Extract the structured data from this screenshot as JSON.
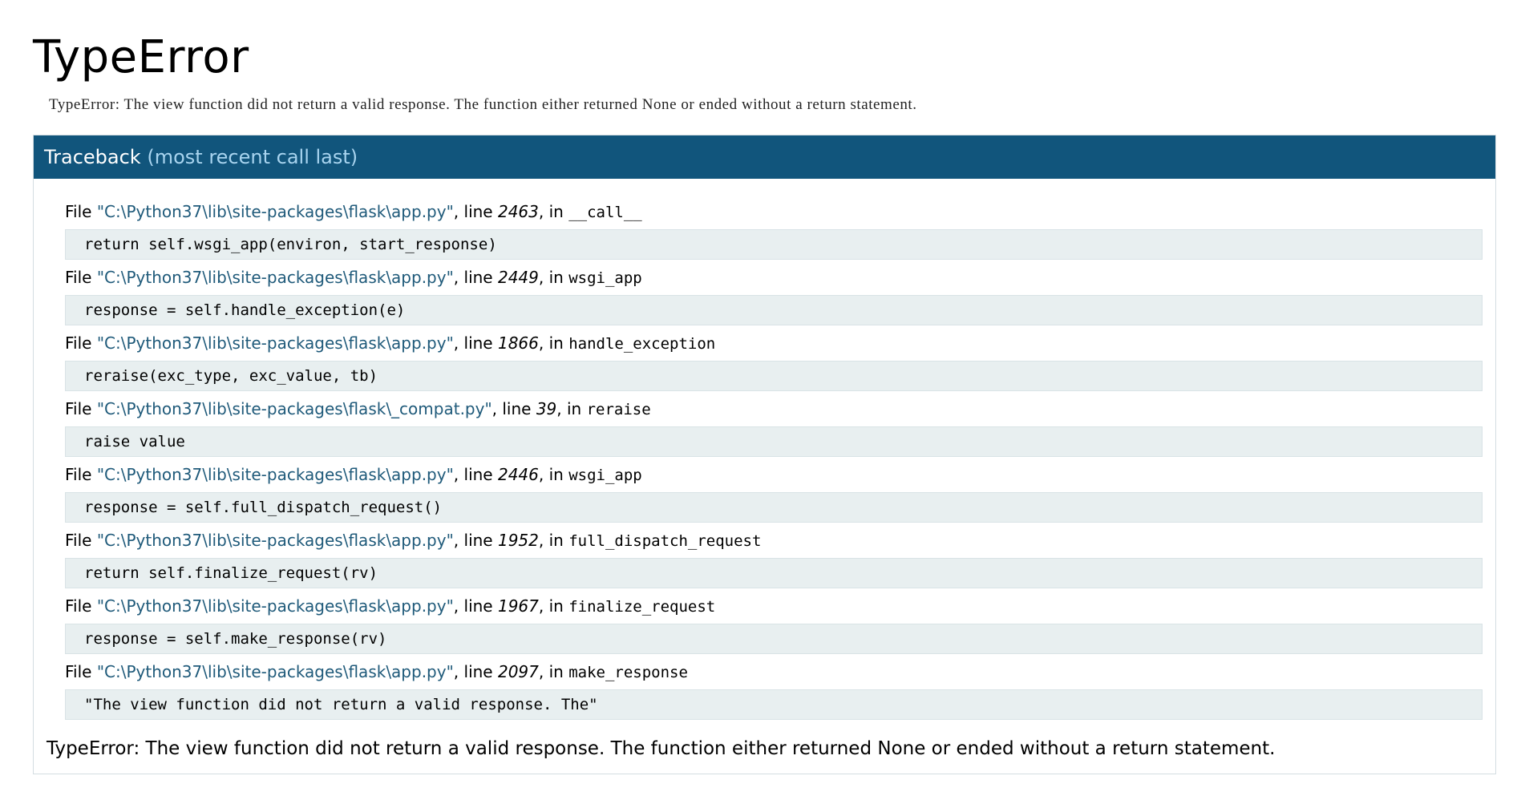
{
  "error_title": "TypeError",
  "error_message": "TypeError: The view function did not return a valid response. The function either returned None or ended without a return statement.",
  "traceback": {
    "header_label": "Traceback",
    "header_sub": "(most recent call last)",
    "file_prefix": "File ",
    "line_prefix": ", line ",
    "in_prefix": ", in ",
    "frames": [
      {
        "filename": "\"C:\\Python37\\lib\\site-packages\\flask\\app.py\"",
        "lineno": "2463",
        "func": "__call__",
        "code": "return self.wsgi_app(environ, start_response)"
      },
      {
        "filename": "\"C:\\Python37\\lib\\site-packages\\flask\\app.py\"",
        "lineno": "2449",
        "func": "wsgi_app",
        "code": "response = self.handle_exception(e)"
      },
      {
        "filename": "\"C:\\Python37\\lib\\site-packages\\flask\\app.py\"",
        "lineno": "1866",
        "func": "handle_exception",
        "code": "reraise(exc_type, exc_value, tb)"
      },
      {
        "filename": "\"C:\\Python37\\lib\\site-packages\\flask\\_compat.py\"",
        "lineno": "39",
        "func": "reraise",
        "code": "raise value"
      },
      {
        "filename": "\"C:\\Python37\\lib\\site-packages\\flask\\app.py\"",
        "lineno": "2446",
        "func": "wsgi_app",
        "code": "response = self.full_dispatch_request()"
      },
      {
        "filename": "\"C:\\Python37\\lib\\site-packages\\flask\\app.py\"",
        "lineno": "1952",
        "func": "full_dispatch_request",
        "code": "return self.finalize_request(rv)"
      },
      {
        "filename": "\"C:\\Python37\\lib\\site-packages\\flask\\app.py\"",
        "lineno": "1967",
        "func": "finalize_request",
        "code": "response = self.make_response(rv)"
      },
      {
        "filename": "\"C:\\Python37\\lib\\site-packages\\flask\\app.py\"",
        "lineno": "2097",
        "func": "make_response",
        "code": "\"The view function did not return a valid response. The\""
      }
    ],
    "final_message": "TypeError: The view function did not return a valid response. The function either returned None or ended without a return statement."
  }
}
